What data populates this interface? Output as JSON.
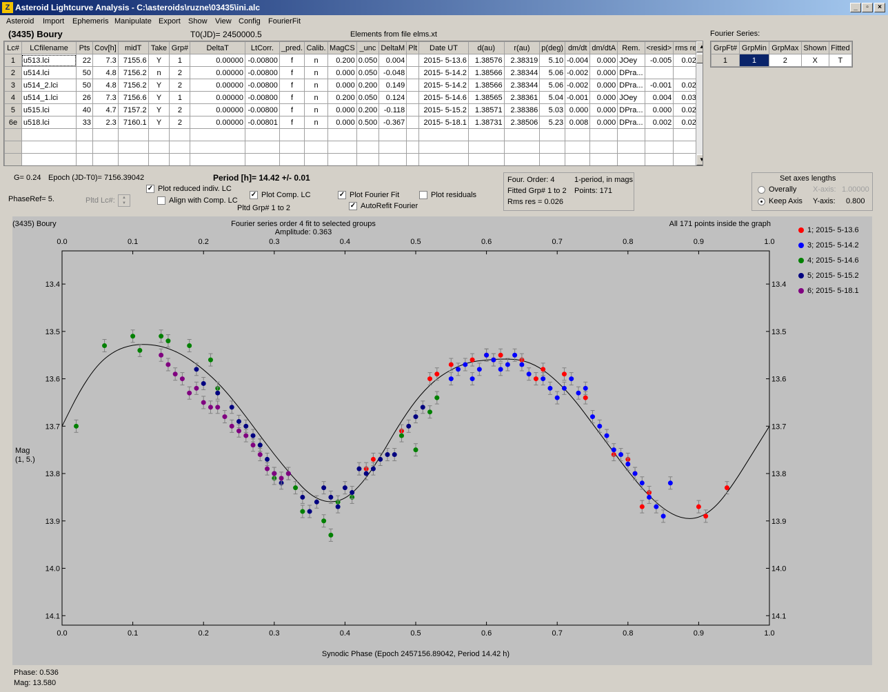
{
  "window": {
    "title": "Asteroid Lightcurve Analysis - C:\\asteroids\\ruzne\\03435\\ini.alc",
    "app_icon": "Z",
    "btn_min": "_",
    "btn_restore": "▫",
    "btn_close": "×"
  },
  "menu": [
    "Asteroid",
    "Import",
    "Ephemeris",
    "Manipulate",
    "Export",
    "Show",
    "View",
    "Config",
    "FourierFit"
  ],
  "header": {
    "object": "(3435) Boury",
    "t0": "T0(JD)= 2450000.5",
    "elements": "Elements from file elms.xt",
    "fourier_label": "Fourier Series:"
  },
  "table": {
    "columns": [
      "Lc#",
      "LCfilename",
      "Pts",
      "Cov[h]",
      "midT",
      "Take",
      "Grp#",
      "DeltaT",
      "LtCorr.",
      "_pred.",
      "Calib.",
      "MagCS",
      "_unc",
      "DeltaM",
      "Plt",
      "Date UT",
      "d(au)",
      "r(au)",
      "p(deg)",
      "dm/dt",
      "dm/dtA",
      "Rem.",
      "<resid>",
      "rms res"
    ],
    "rows": [
      [
        "1",
        "u513.lci",
        "22",
        "7.3",
        "7155.6",
        "Y",
        "1",
        "0.00000",
        "-0.00800",
        "f",
        "n",
        "0.200",
        "0.050",
        "0.004",
        "",
        "2015- 5-13.6",
        "1.38576",
        "2.38319",
        "5.10",
        "-0.004",
        "0.000",
        "JOey",
        "-0.005",
        "0.025"
      ],
      [
        "2",
        "u514.lci",
        "50",
        "4.8",
        "7156.2",
        "n",
        "2",
        "0.00000",
        "-0.00800",
        "f",
        "n",
        "0.000",
        "0.050",
        "-0.048",
        "",
        "2015- 5-14.2",
        "1.38566",
        "2.38344",
        "5.06",
        "-0.002",
        "0.000",
        "DPra...",
        "",
        ""
      ],
      [
        "3",
        "u514_2.lci",
        "50",
        "4.8",
        "7156.2",
        "Y",
        "2",
        "0.00000",
        "-0.00800",
        "f",
        "n",
        "0.000",
        "0.200",
        "0.149",
        "",
        "2015- 5-14.2",
        "1.38566",
        "2.38344",
        "5.06",
        "-0.002",
        "0.000",
        "DPra...",
        "-0.001",
        "0.025"
      ],
      [
        "4",
        "u514_1.lci",
        "26",
        "7.3",
        "7156.6",
        "Y",
        "1",
        "0.00000",
        "-0.00800",
        "f",
        "n",
        "0.200",
        "0.050",
        "0.124",
        "",
        "2015- 5-14.6",
        "1.38565",
        "2.38361",
        "5.04",
        "-0.001",
        "0.000",
        "JOey",
        "0.004",
        "0.031"
      ],
      [
        "5",
        "u515.lci",
        "40",
        "4.7",
        "7157.2",
        "Y",
        "2",
        "0.00000",
        "-0.00800",
        "f",
        "n",
        "0.000",
        "0.200",
        "-0.118",
        "",
        "2015- 5-15.2",
        "1.38571",
        "2.38386",
        "5.03",
        "0.000",
        "0.000",
        "DPra...",
        "0.000",
        "0.022"
      ],
      [
        "6e",
        "u518.lci",
        "33",
        "2.3",
        "7160.1",
        "Y",
        "2",
        "0.00000",
        "-0.00801",
        "f",
        "n",
        "0.000",
        "0.500",
        "-0.367",
        "",
        "2015- 5-18.1",
        "1.38731",
        "2.38506",
        "5.23",
        "0.008",
        "0.000",
        "DPra...",
        "0.002",
        "0.026"
      ]
    ],
    "empty_rows": 3,
    "scroll_up": "▲",
    "scroll_down": "▼"
  },
  "fourier_table": {
    "columns": [
      "GrpFt#",
      "GrpMin",
      "GrpMax",
      "Shown",
      "Fitted"
    ],
    "row": [
      "1",
      "1",
      "2",
      "X",
      "T"
    ]
  },
  "controls": {
    "g": "G= 0.24",
    "epoch": "Epoch (JD-T0)= 7156.39042",
    "period": "Period [h]= 14.42 +/- 0.01",
    "phaseref": "PhaseRef= 5.",
    "pltd_lc": "Pltd Lc#:",
    "spin_up": "▲",
    "spin_down": "▼",
    "plot_reduced": "Plot reduced indiv. LC",
    "align_comp": "Align with Comp. LC",
    "plot_comp": "Plot Comp. LC",
    "pltd_grp": "Pltd Grp#  1   to   2",
    "plot_fourier": "Plot Fourier Fit",
    "autorefit": "AutoRefit Fourier",
    "plot_residuals": "Plot residuals",
    "check_mark": "✓",
    "info_order": "Four. Order:  4",
    "info_period": "1-period, in mags",
    "info_fitted": "Fitted Grp# 1 to 2",
    "info_points": "Points: 171",
    "info_rms": "Rms res     = 0.026",
    "axes_title": "Set axes lengths",
    "overally": "Overally",
    "keep_axis": "Keep Axis",
    "xaxis_label": "X-axis:",
    "xaxis_value": "1.00000",
    "yaxis_label": "Y-axis:",
    "yaxis_value": "0.800"
  },
  "plot": {
    "object": "(3435) Boury",
    "fit_title": "Fourier series order 4 fit to selected groups",
    "amplitude": "Amplitude: 0.363",
    "points_note": "All 171 points inside the graph",
    "ylabel": "Mag",
    "ylabel2": "(1, 5.)",
    "xlabel": "Synodic Phase (Epoch 2457156.89042, Period 14.42 h)"
  },
  "status": {
    "phase": "Phase:  0.536",
    "mag": "Mag:    13.580"
  },
  "chart_data": {
    "type": "scatter",
    "title": "Fourier series order 4 fit to selected groups",
    "xlabel": "Synodic Phase (Epoch 2457156.89042, Period 14.42 h)",
    "ylabel": "Mag (1, 5.)",
    "xlim": [
      0.0,
      1.0
    ],
    "ylim": [
      14.12,
      13.33
    ],
    "y_inverted": true,
    "x_ticks": [
      "0.0",
      "0.1",
      "0.2",
      "0.3",
      "0.4",
      "0.5",
      "0.6",
      "0.7",
      "0.8",
      "0.9",
      "1.0"
    ],
    "y_ticks": [
      "13.4",
      "13.5",
      "13.6",
      "13.7",
      "13.8",
      "13.9",
      "14.0",
      "14.1"
    ],
    "legend_position": "right",
    "fourier_fit": {
      "x": [
        0.0,
        0.025,
        0.05,
        0.075,
        0.1,
        0.125,
        0.15,
        0.175,
        0.2,
        0.225,
        0.25,
        0.275,
        0.3,
        0.325,
        0.35,
        0.375,
        0.4,
        0.425,
        0.45,
        0.475,
        0.5,
        0.525,
        0.55,
        0.575,
        0.6,
        0.625,
        0.65,
        0.675,
        0.7,
        0.725,
        0.75,
        0.775,
        0.8,
        0.825,
        0.85,
        0.875,
        0.9,
        0.925,
        0.95,
        0.975,
        1.0
      ],
      "y": [
        13.7,
        13.625,
        13.57,
        13.54,
        13.528,
        13.527,
        13.535,
        13.553,
        13.58,
        13.615,
        13.66,
        13.71,
        13.76,
        13.805,
        13.845,
        13.862,
        13.855,
        13.82,
        13.765,
        13.7,
        13.645,
        13.605,
        13.58,
        13.565,
        13.56,
        13.558,
        13.56,
        13.575,
        13.605,
        13.645,
        13.695,
        13.745,
        13.795,
        13.84,
        13.875,
        13.895,
        13.895,
        13.87,
        13.82,
        13.76,
        13.7
      ]
    },
    "series": [
      {
        "name": "1; 2015- 5-13.6",
        "color": "#ff0000",
        "x": [
          0.43,
          0.44,
          0.48,
          0.52,
          0.53,
          0.55,
          0.58,
          0.6,
          0.61,
          0.62,
          0.65,
          0.67,
          0.68,
          0.71,
          0.74,
          0.78,
          0.8,
          0.81,
          0.82,
          0.83,
          0.9,
          0.91,
          0.94
        ],
        "y": [
          13.79,
          13.77,
          13.71,
          13.6,
          13.59,
          13.57,
          13.56,
          13.55,
          13.56,
          13.55,
          13.56,
          13.6,
          13.58,
          13.59,
          13.64,
          13.76,
          13.77,
          13.8,
          13.87,
          13.84,
          13.87,
          13.89,
          13.83
        ]
      },
      {
        "name": "3; 2015- 5-14.2",
        "color": "#0000ff",
        "x": [
          0.55,
          0.56,
          0.57,
          0.58,
          0.59,
          0.6,
          0.61,
          0.62,
          0.63,
          0.64,
          0.65,
          0.66,
          0.68,
          0.69,
          0.7,
          0.71,
          0.72,
          0.73,
          0.74,
          0.75,
          0.76,
          0.77,
          0.78,
          0.79,
          0.8,
          0.81,
          0.82,
          0.83,
          0.84,
          0.85,
          0.86
        ],
        "y": [
          13.6,
          13.58,
          13.57,
          13.6,
          13.58,
          13.55,
          13.56,
          13.58,
          13.57,
          13.55,
          13.57,
          13.59,
          13.6,
          13.62,
          13.64,
          13.62,
          13.6,
          13.63,
          13.62,
          13.68,
          13.7,
          13.72,
          13.75,
          13.76,
          13.78,
          13.8,
          13.82,
          13.85,
          13.87,
          13.89,
          13.82
        ]
      },
      {
        "name": "4; 2015- 5-14.6",
        "color": "#008000",
        "x": [
          0.02,
          0.06,
          0.1,
          0.11,
          0.14,
          0.15,
          0.18,
          0.21,
          0.22,
          0.28,
          0.3,
          0.33,
          0.34,
          0.37,
          0.38,
          0.39,
          0.41,
          0.48,
          0.5,
          0.52,
          0.53
        ],
        "y": [
          13.7,
          13.53,
          13.51,
          13.54,
          13.51,
          13.52,
          13.53,
          13.56,
          13.62,
          13.74,
          13.81,
          13.83,
          13.88,
          13.9,
          13.93,
          13.86,
          13.85,
          13.72,
          13.75,
          13.67,
          13.64
        ]
      },
      {
        "name": "5; 2015- 5-15.2",
        "color": "#000080",
        "x": [
          0.19,
          0.2,
          0.22,
          0.24,
          0.25,
          0.26,
          0.27,
          0.28,
          0.29,
          0.3,
          0.31,
          0.32,
          0.34,
          0.35,
          0.36,
          0.37,
          0.38,
          0.39,
          0.4,
          0.41,
          0.42,
          0.43,
          0.44,
          0.45,
          0.46,
          0.47,
          0.49,
          0.5,
          0.51
        ],
        "y": [
          13.58,
          13.61,
          13.63,
          13.66,
          13.69,
          13.7,
          13.72,
          13.74,
          13.77,
          13.8,
          13.82,
          13.8,
          13.85,
          13.88,
          13.86,
          13.83,
          13.85,
          13.87,
          13.83,
          13.84,
          13.79,
          13.8,
          13.79,
          13.77,
          13.76,
          13.76,
          13.7,
          13.68,
          13.66
        ]
      },
      {
        "name": "6; 2015- 5-18.1",
        "color": "#800080",
        "x": [
          0.14,
          0.15,
          0.16,
          0.17,
          0.18,
          0.19,
          0.2,
          0.21,
          0.22,
          0.23,
          0.24,
          0.25,
          0.26,
          0.27,
          0.28,
          0.29,
          0.3,
          0.31,
          0.32
        ],
        "y": [
          13.55,
          13.57,
          13.59,
          13.6,
          13.63,
          13.62,
          13.65,
          13.66,
          13.66,
          13.68,
          13.7,
          13.71,
          13.72,
          13.74,
          13.76,
          13.79,
          13.8,
          13.81,
          13.8
        ]
      }
    ]
  }
}
